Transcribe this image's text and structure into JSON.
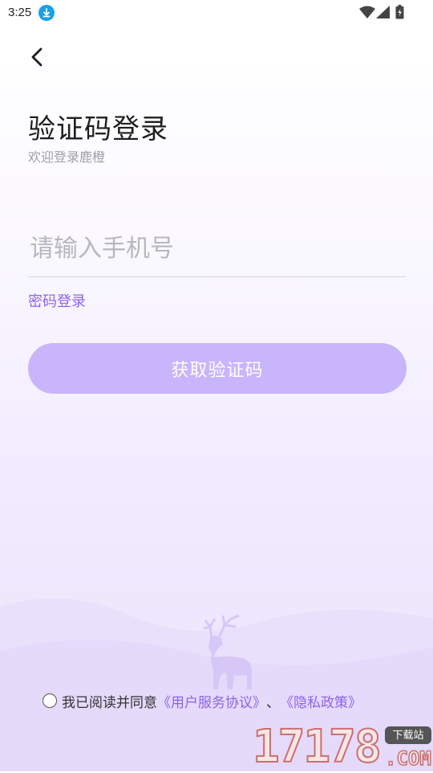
{
  "status_bar": {
    "time": "3:25"
  },
  "page": {
    "title": "验证码登录",
    "subtitle": "欢迎登录鹿橙"
  },
  "phone_input": {
    "placeholder": "请输入手机号",
    "value": ""
  },
  "password_login_label": "密码登录",
  "get_code_button": "获取验证码",
  "agreement": {
    "checked": false,
    "prefix": "我已阅读并同意",
    "terms_link": "《用户服务协议》",
    "separator": "、",
    "privacy_link": "《隐私政策》"
  },
  "watermark": {
    "number": "17178",
    "badge": "下载站",
    "suffix": ".COM"
  },
  "colors": {
    "accent": "#8e63e8",
    "button_bg": "#c8b5fb",
    "download_icon": "#1aa0e8"
  },
  "icons": [
    "download-icon",
    "wifi-icon",
    "signal-icon",
    "battery-icon",
    "back-arrow-icon",
    "deer-icon"
  ]
}
